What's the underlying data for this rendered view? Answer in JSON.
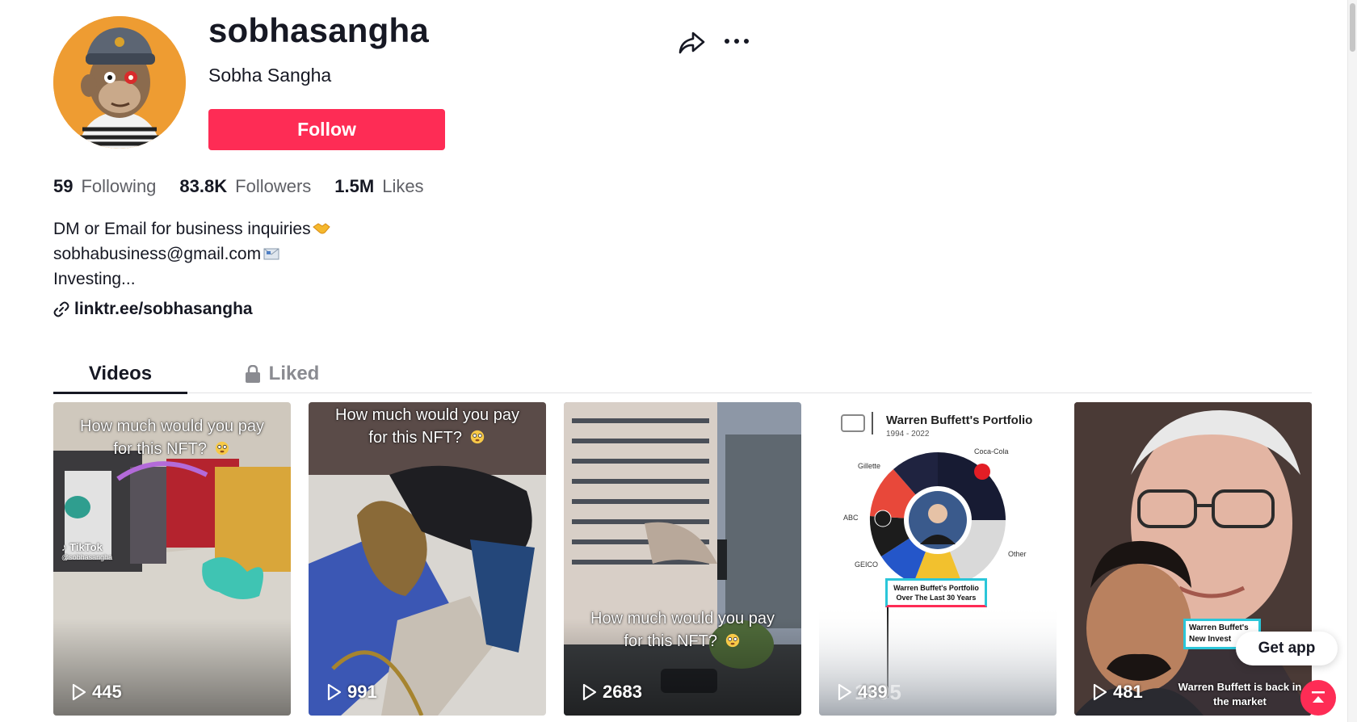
{
  "profile": {
    "username": "sobhasangha",
    "nickname": "Sobha Sangha",
    "follow_label": "Follow",
    "avatar_bg": "#ee9c32"
  },
  "stats": [
    {
      "value": "59",
      "label": "Following"
    },
    {
      "value": "83.8K",
      "label": "Followers"
    },
    {
      "value": "1.5M",
      "label": "Likes"
    }
  ],
  "bio": {
    "line1": "DM or Email for business inquiries",
    "line1_icon": "handshake-emoji",
    "line2": "sobhabusiness@gmail.com",
    "line2_icon": "envelope-emoji",
    "line3": "Investing..."
  },
  "link": {
    "text": "linktr.ee/sobhasangha",
    "icon": "link-icon"
  },
  "tabs": [
    {
      "label": "Videos",
      "active": true
    },
    {
      "label": "Liked",
      "icon": "lock-icon",
      "active": false
    }
  ],
  "videos": [
    {
      "caption": "How much would you pay for this NFT?",
      "caption_emoji": "flushed-face-emoji",
      "watermark": "TikTok",
      "watermark_handle": "@sobhasangha",
      "plays": "445"
    },
    {
      "caption": "How much would you pay for this NFT?",
      "caption_emoji": "flushed-face-emoji",
      "plays": "991"
    },
    {
      "caption": "How much would you pay for this NFT?",
      "caption_emoji": "flushed-face-emoji",
      "plays": "2683"
    },
    {
      "plays": "439",
      "chart_title": "Warren Buffett's Portfolio",
      "chart_subtitle": "1994 - 2022",
      "slices": [
        "Coca-Cola",
        "Gillette",
        "ABC",
        "GEICO",
        "Other"
      ],
      "box_label_line1": "Warren Buffet's Portfolio",
      "box_label_line2": "Over The Last 30 Years",
      "year": "1995"
    },
    {
      "plays": "481",
      "box_line1": "Warren Buffet's",
      "box_line2": "New Invest",
      "caption": "Warren Buffett is back in the market"
    }
  ],
  "floating": {
    "get_app_label": "Get app"
  },
  "colors": {
    "accent": "#fe2c55",
    "text": "#161823",
    "muted": "#5f6066"
  }
}
